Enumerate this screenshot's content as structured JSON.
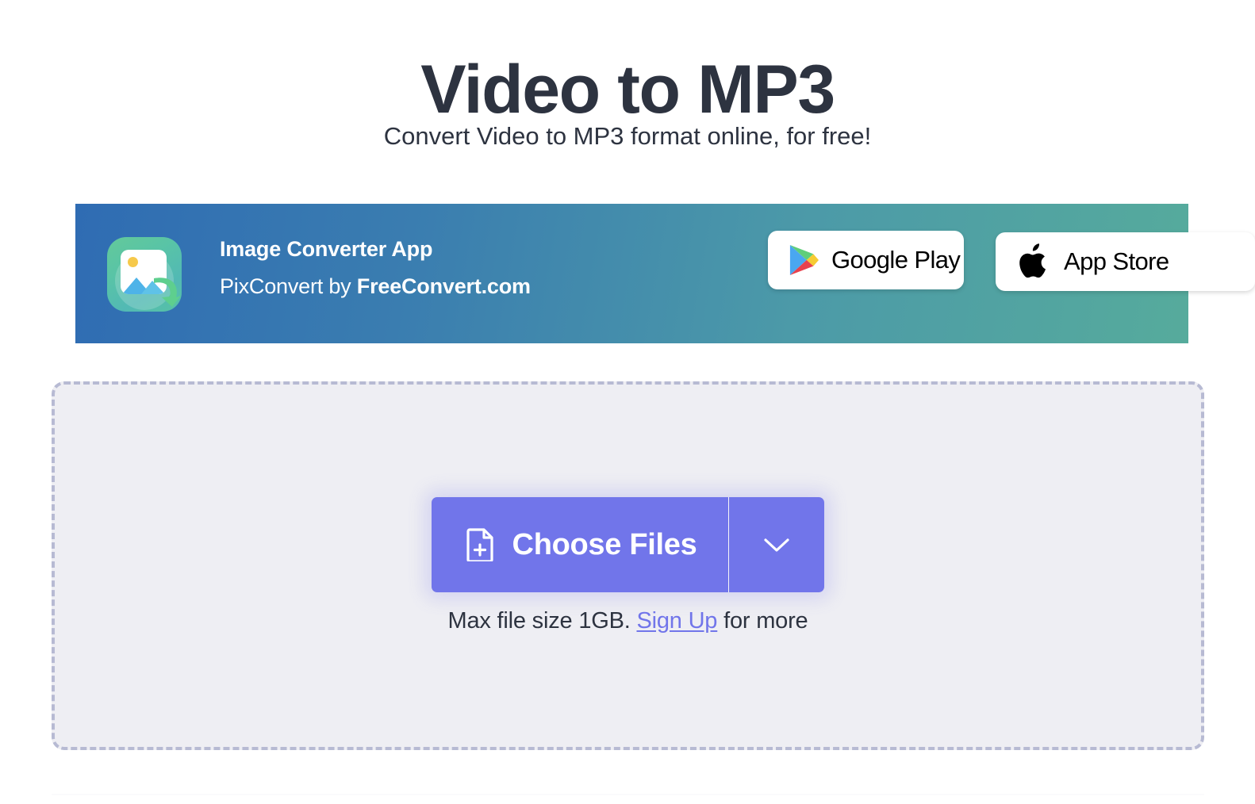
{
  "header": {
    "title": "Video to MP3",
    "subtitle": "Convert Video to MP3 format online, for free!",
    "title_color": "#2d3340"
  },
  "promo_banner": {
    "app_name": "Image Converter App",
    "byline_prefix": "PixConvert by ",
    "byline_brand": "FreeConvert.com",
    "icon_name": "image-converter-app-icon",
    "gradient_start": "#2f6cb3",
    "gradient_end": "#56ab9c",
    "store_buttons": [
      {
        "label": "Google Play",
        "icon": "google-play-icon"
      },
      {
        "label": "App Store",
        "icon": "apple-icon"
      }
    ]
  },
  "dropzone": {
    "choose_files_label": "Choose Files",
    "choose_files_icon": "file-plus-icon",
    "dropdown_icon": "chevron-down-icon",
    "accent_color": "#7175ea",
    "fill_color": "#eeeef3",
    "border_color": "#b7bad3",
    "hint_prefix": "Max file size 1GB. ",
    "hint_link": "Sign Up",
    "hint_suffix": " for more"
  }
}
